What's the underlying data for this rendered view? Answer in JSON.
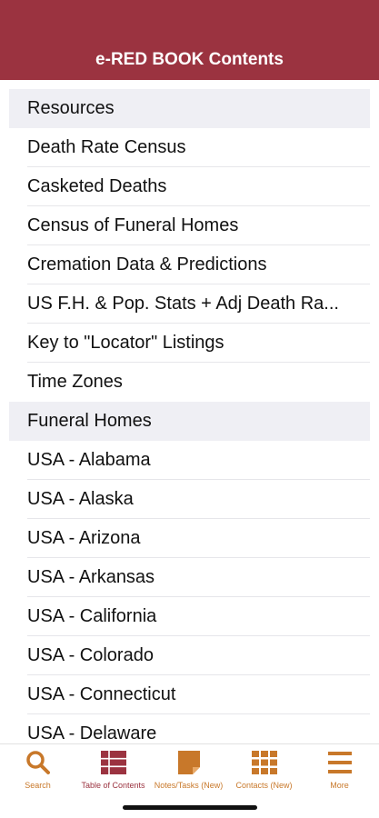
{
  "header": {
    "title": "e-RED BOOK Contents"
  },
  "sections": [
    {
      "title": "Resources",
      "items": [
        "Death Rate Census",
        "Casketed Deaths",
        "Census of Funeral Homes",
        "Cremation Data & Predictions",
        "US F.H. & Pop. Stats + Adj Death Ra...",
        "Key to \"Locator\" Listings",
        "Time Zones"
      ]
    },
    {
      "title": "Funeral Homes",
      "items": [
        "USA - Alabama",
        "USA - Alaska",
        "USA - Arizona",
        "USA - Arkansas",
        "USA - California",
        "USA - Colorado",
        "USA - Connecticut",
        "USA - Delaware"
      ]
    }
  ],
  "tabbar": {
    "active_color": "#9b3340",
    "inactive_color": "#c8782a",
    "tabs": [
      {
        "label": "Search",
        "icon": "search-icon",
        "active": false
      },
      {
        "label": "Table of Contents",
        "icon": "table-of-contents-icon",
        "active": true
      },
      {
        "label": "Notes/Tasks (New)",
        "icon": "sticky-note-icon",
        "active": false
      },
      {
        "label": "Contacts (New)",
        "icon": "grid-icon",
        "active": false
      },
      {
        "label": "More",
        "icon": "menu-icon",
        "active": false
      }
    ]
  }
}
